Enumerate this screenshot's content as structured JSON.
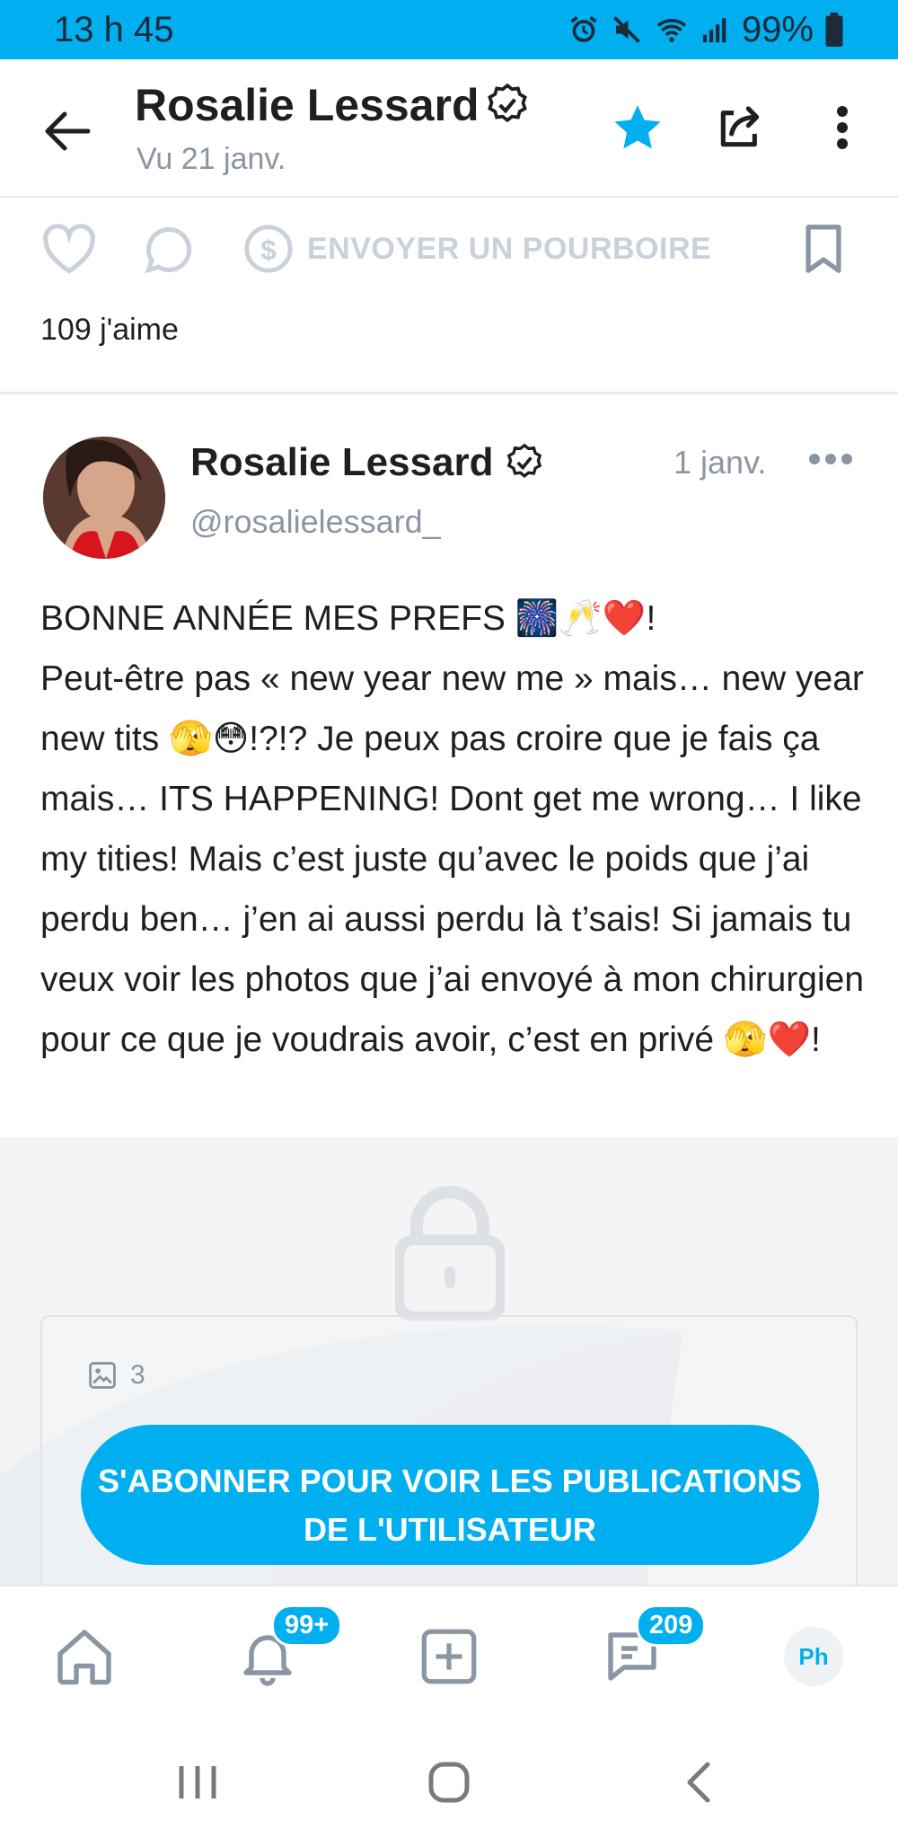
{
  "status_bar": {
    "time": "13 h 45",
    "battery": "99%"
  },
  "header": {
    "title": "Rosalie Lessard",
    "subtitle": "Vu  21 janv."
  },
  "actions": {
    "tip_label": "ENVOYER UN POURBOIRE",
    "likes": "109 j'aime"
  },
  "post": {
    "author": "Rosalie Lessard",
    "handle": "@rosalielessard_",
    "date": "1 janv.",
    "text": "BONNE ANNÉE MES PREFS 🎆🥂❤️!\nPeut-être pas « new year new me » mais… new year new tits 🫣😳!?!? Je peux pas croire que je fais ça mais… ITS HAPPENING! Dont get me wrong… I like my tities! Mais c’est juste qu’avec le poids que j’ai perdu ben… j’en ai aussi perdu là t’sais! Si jamais tu veux voir les photos que j’ai envoyé à mon chirurgien pour ce que je voudrais avoir, c’est en privé 🫣❤️!",
    "media_count": "3",
    "subscribe_label": "S'ABONNER POUR VOIR LES PUBLICATIONS DE L'UTILISATEUR"
  },
  "bottom_nav": {
    "notifications_badge": "99+",
    "messages_badge": "209",
    "profile_initials": "Ph"
  },
  "colors": {
    "accent": "#00aff0",
    "muted": "#8a96a3",
    "disabled": "#c9d1da"
  }
}
